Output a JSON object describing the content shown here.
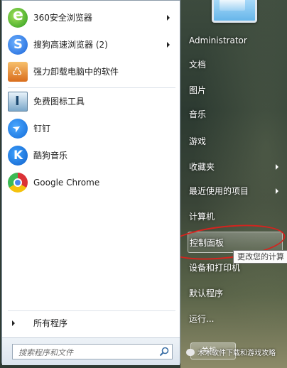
{
  "programs": [
    {
      "label": "360安全浏览器",
      "icon": "browser-360-icon",
      "has_submenu": true
    },
    {
      "label": "搜狗高速浏览器 (2)",
      "icon": "sogou-browser-icon",
      "has_submenu": true
    },
    {
      "label": "强力卸载电脑中的软件",
      "icon": "uninstall-icon",
      "has_submenu": false
    },
    {
      "label": "免费图标工具",
      "icon": "icon-tool-icon",
      "has_submenu": false
    },
    {
      "label": "钉钉",
      "icon": "dingtalk-icon",
      "has_submenu": false
    },
    {
      "label": "酷狗音乐",
      "icon": "kugou-music-icon",
      "has_submenu": false
    },
    {
      "label": "Google Chrome",
      "icon": "chrome-icon",
      "has_submenu": false
    }
  ],
  "all_programs_label": "所有程序",
  "search": {
    "placeholder": "搜索程序和文件"
  },
  "right_menu": [
    {
      "label": "Administrator",
      "has_submenu": false
    },
    {
      "label": "文档",
      "has_submenu": false
    },
    {
      "label": "图片",
      "has_submenu": false
    },
    {
      "label": "音乐",
      "has_submenu": false
    },
    {
      "label": "游戏",
      "has_submenu": false
    },
    {
      "label": "收藏夹",
      "has_submenu": true
    },
    {
      "label": "最近使用的项目",
      "has_submenu": true
    },
    {
      "label": "计算机",
      "has_submenu": false
    },
    {
      "label": "控制面板",
      "has_submenu": false,
      "highlighted": true
    },
    {
      "label": "设备和打印机",
      "has_submenu": false
    },
    {
      "label": "默认程序",
      "has_submenu": false
    },
    {
      "label": "运行...",
      "has_submenu": false
    }
  ],
  "tooltip": "更改您的计算",
  "shutdown_label": "关机",
  "watermark": "木木软件下载和游戏攻略",
  "colors": {
    "annotation_ellipse": "#d6231e",
    "left_pane_bg": "#ffffff"
  }
}
